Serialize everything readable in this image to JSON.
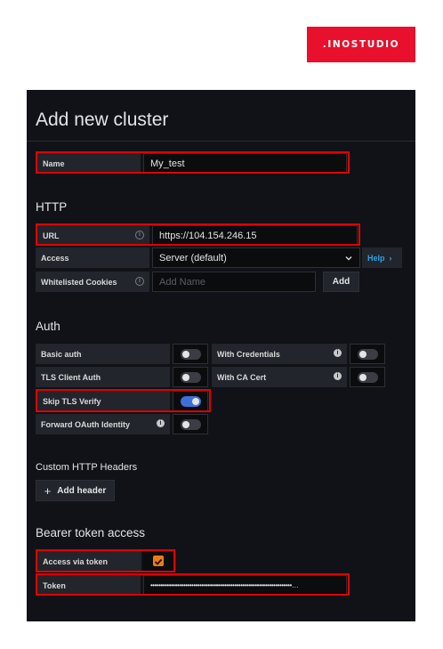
{
  "brand": {
    "logo_text": ".INOSTUDIO"
  },
  "page": {
    "title": "Add new cluster"
  },
  "name_field": {
    "label": "Name",
    "value": "My_test"
  },
  "http": {
    "section_title": "HTTP",
    "url": {
      "label": "URL",
      "value": "https://104.154.246.15"
    },
    "access": {
      "label": "Access",
      "value": "Server (default)",
      "help_label": "Help"
    },
    "cookies": {
      "label": "Whitelisted Cookies",
      "placeholder": "Add Name",
      "add_label": "Add"
    }
  },
  "auth": {
    "section_title": "Auth",
    "basic_auth": {
      "label": "Basic auth",
      "enabled": false
    },
    "with_credentials": {
      "label": "With Credentials",
      "enabled": false
    },
    "tls_client_auth": {
      "label": "TLS Client Auth",
      "enabled": false
    },
    "with_ca_cert": {
      "label": "With CA Cert",
      "enabled": false
    },
    "skip_tls_verify": {
      "label": "Skip TLS Verify",
      "enabled": true
    },
    "forward_oauth": {
      "label": "Forward OAuth Identity",
      "enabled": false
    }
  },
  "custom_headers": {
    "title": "Custom HTTP Headers",
    "add_button": "Add header"
  },
  "bearer": {
    "section_title": "Bearer token access",
    "access_via_token": {
      "label": "Access via token",
      "checked": true
    },
    "token": {
      "label": "Token",
      "value": "•••••••••••••••••••••••••••••••••••••••••••••••••••••••••••••••••••••…"
    }
  },
  "colors": {
    "highlight": "#e00000",
    "toggle_on": "#3d71d9",
    "checkbox": "#eb7b18",
    "help_link": "#33a2e5",
    "brand": "#e8102c"
  }
}
